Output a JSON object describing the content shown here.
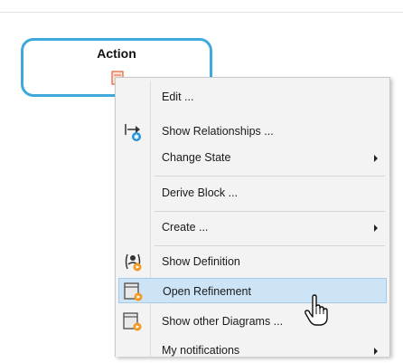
{
  "node": {
    "title": "Action"
  },
  "menu": {
    "items": [
      {
        "label": "Edit ...",
        "icon": "none",
        "submenu": false
      },
      {
        "label": "Show Relationships ...",
        "icon": "relationships-icon",
        "submenu": false
      },
      {
        "label": "Change State",
        "icon": "none",
        "submenu": true
      },
      {
        "label": "Derive Block ...",
        "icon": "none",
        "submenu": false
      },
      {
        "label": "Create ...",
        "icon": "none",
        "submenu": true
      },
      {
        "label": "Show Definition",
        "icon": "show-definition-icon",
        "submenu": false
      },
      {
        "label": "Open Refinement",
        "icon": "open-refinement-icon",
        "submenu": false,
        "highlighted": true
      },
      {
        "label": "Show other Diagrams ...",
        "icon": "diagrams-icon",
        "submenu": false
      },
      {
        "label": "My notifications",
        "icon": "none",
        "submenu": true
      }
    ]
  },
  "colors": {
    "node_border": "#3fa9dc",
    "highlight": "#cde4f7",
    "accent_orange": "#f39a1e"
  }
}
